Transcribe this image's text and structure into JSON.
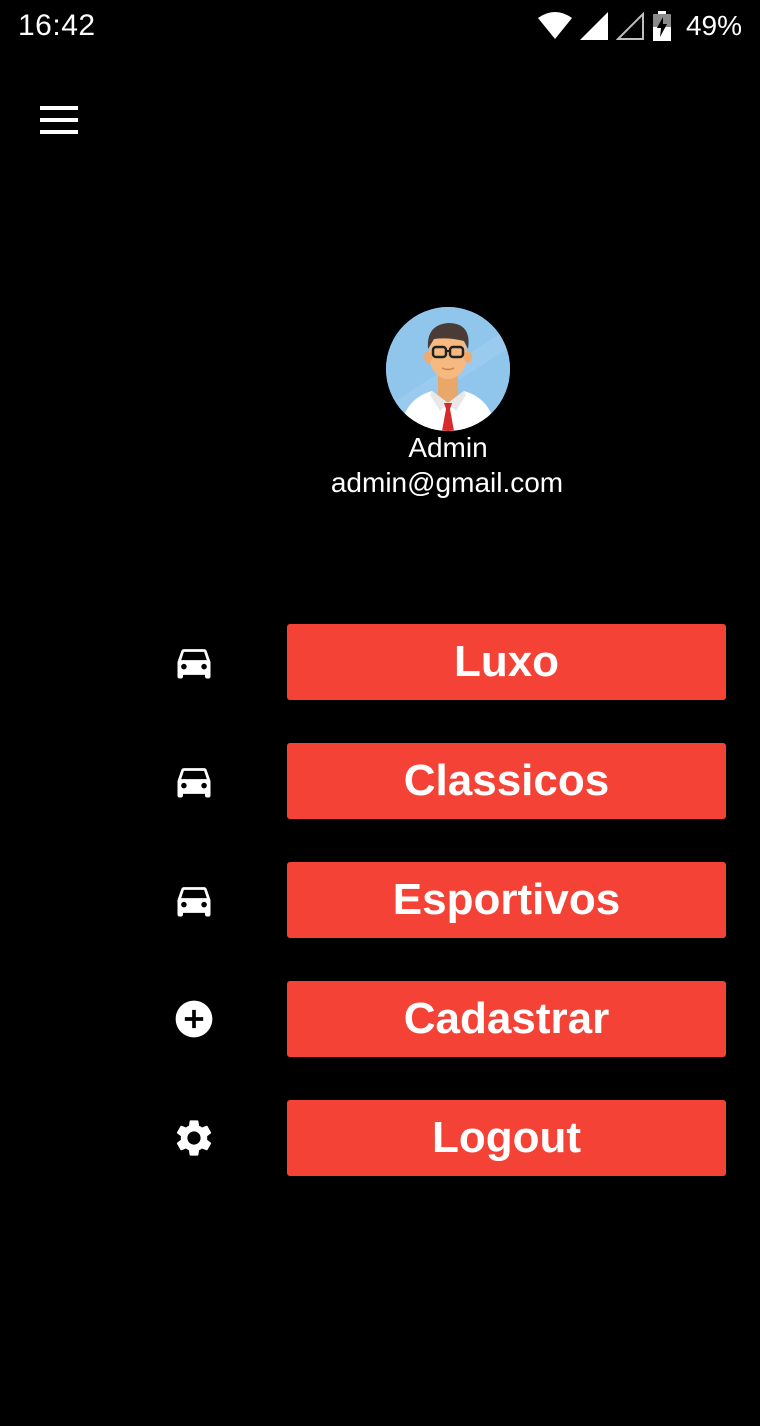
{
  "status_bar": {
    "time": "16:42",
    "battery": "49%",
    "icons": [
      "wifi-icon",
      "signal-icon",
      "signal-empty-icon",
      "battery-charging-icon"
    ]
  },
  "header": {
    "menu_icon": "hamburger-icon"
  },
  "profile": {
    "name": "Admin",
    "email": "admin@gmail.com",
    "avatar_icon": "user-avatar"
  },
  "menu": {
    "items": [
      {
        "label": "Luxo",
        "icon": "car-icon"
      },
      {
        "label": "Classicos",
        "icon": "car-icon"
      },
      {
        "label": "Esportivos",
        "icon": "car-icon"
      },
      {
        "label": "Cadastrar",
        "icon": "add-circle-icon"
      },
      {
        "label": "Logout",
        "icon": "gear-icon"
      }
    ]
  },
  "colors": {
    "background": "#000000",
    "button": "#f44336",
    "text": "#ffffff"
  }
}
